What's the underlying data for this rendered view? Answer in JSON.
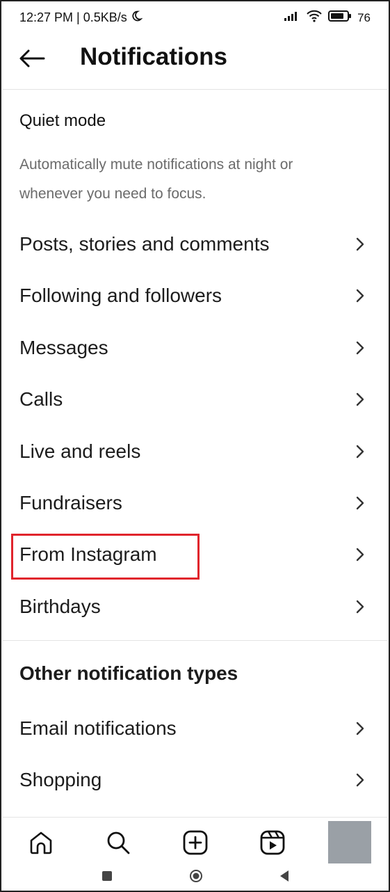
{
  "status_bar": {
    "time_speed": "12:27 PM | 0.5KB/s",
    "battery": "76",
    "moon_icon": "moon-icon",
    "signal_icon": "signal-icon",
    "wifi_icon": "wifi-icon",
    "battery_icon": "battery-icon"
  },
  "header": {
    "title": "Notifications",
    "back_icon": "back-arrow-icon"
  },
  "quiet_mode": {
    "title": "Quiet mode",
    "description": "Automatically mute notifications at night or whenever you need to focus."
  },
  "menu": [
    {
      "label": "Posts, stories and comments"
    },
    {
      "label": "Following and followers"
    },
    {
      "label": "Messages"
    },
    {
      "label": "Calls"
    },
    {
      "label": "Live and reels"
    },
    {
      "label": "Fundraisers"
    },
    {
      "label": "From Instagram"
    },
    {
      "label": "Birthdays"
    }
  ],
  "other_section": {
    "heading": "Other notification types",
    "items": [
      {
        "label": "Email notifications"
      },
      {
        "label": "Shopping"
      }
    ]
  },
  "highlight_color": "#e0242c",
  "bottom_nav": {
    "icons": [
      "home-icon",
      "search-icon",
      "create-icon",
      "reels-icon",
      "profile-tile"
    ]
  },
  "system_nav": {
    "icons": [
      "recents-square-icon",
      "home-circle-icon",
      "back-triangle-icon"
    ]
  }
}
